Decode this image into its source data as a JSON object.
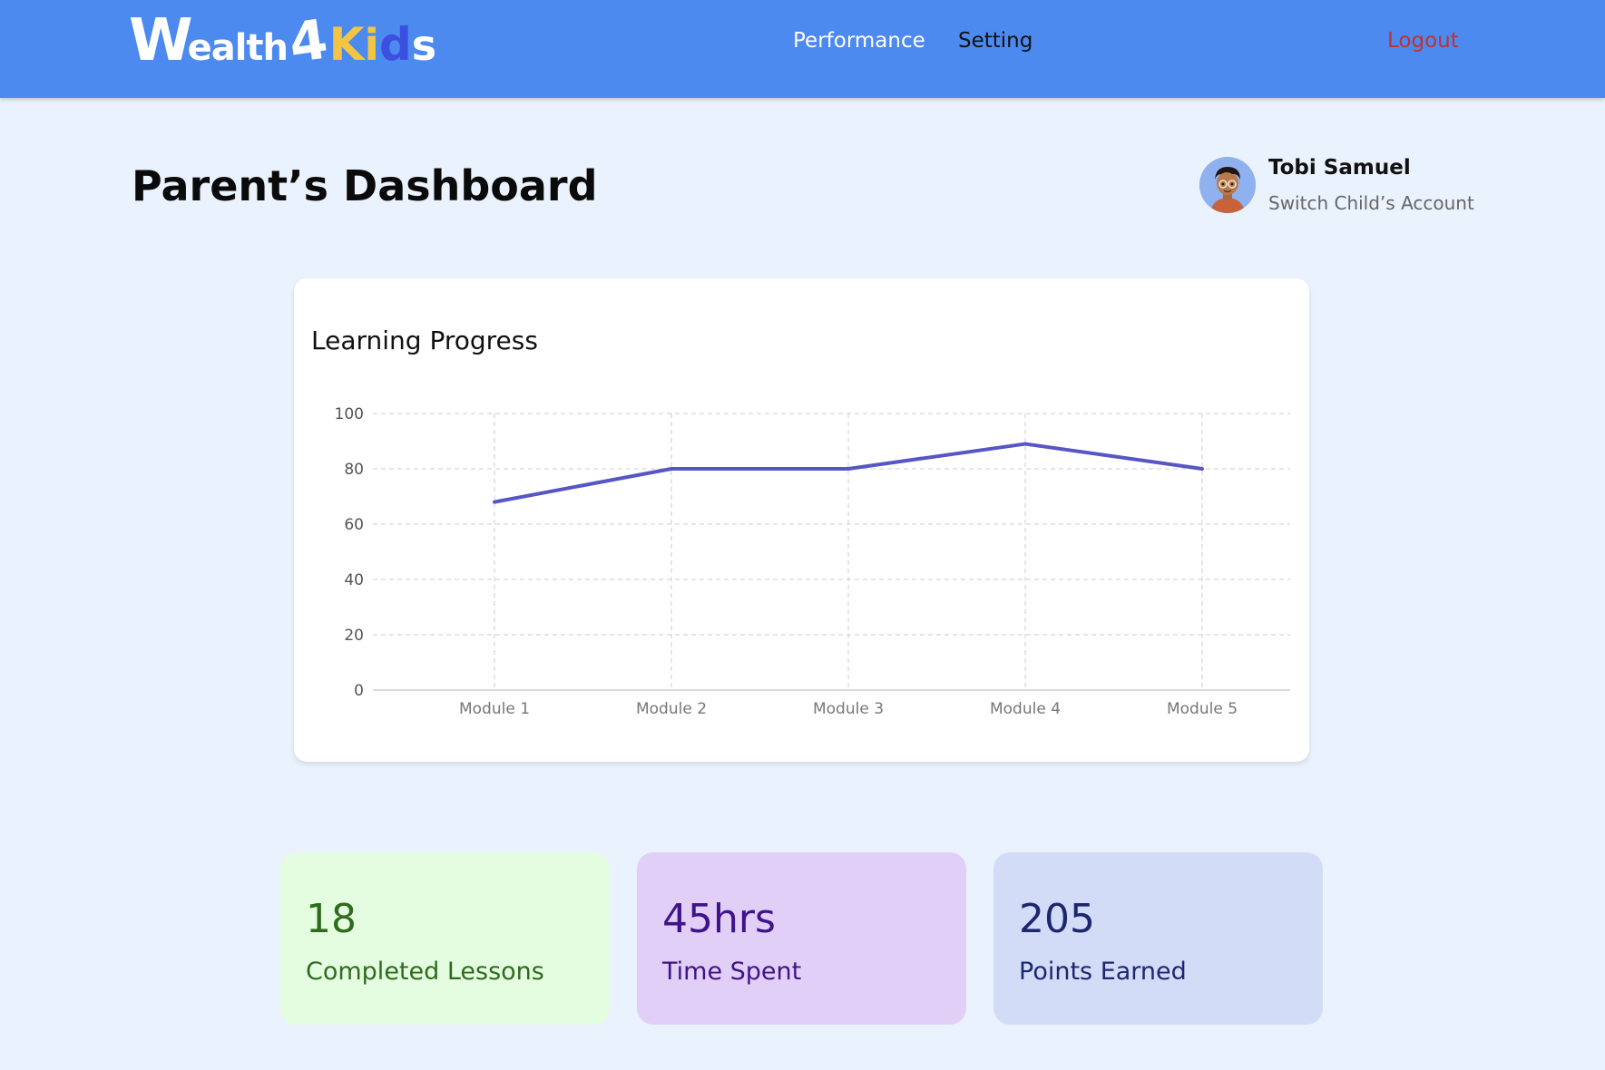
{
  "header": {
    "logo": {
      "w": "W",
      "ealth": "ealth",
      "four": "4",
      "k": "K",
      "i": "i",
      "d": "d",
      "s": "s"
    },
    "nav": {
      "performance": "Performance",
      "setting": "Setting",
      "logout": "Logout"
    }
  },
  "page": {
    "title": "Parent’s Dashboard"
  },
  "user": {
    "name": "Tobi Samuel",
    "switch_label": "Switch Child’s Account"
  },
  "chart_card": {
    "title": "Learning Progress"
  },
  "chart_data": {
    "type": "line",
    "title": "Learning Progress",
    "categories": [
      "Module 1",
      "Module 2",
      "Module 3",
      "Module 4",
      "Module 5"
    ],
    "series": [
      {
        "values": [
          68,
          80,
          80,
          89,
          80
        ],
        "color": "#5656c4"
      }
    ],
    "yticks": [
      0,
      20,
      40,
      60,
      80,
      100
    ],
    "ylim": [
      0,
      100
    ],
    "grid": true,
    "xlabel": "",
    "ylabel": ""
  },
  "stats": {
    "lessons": {
      "value": "18",
      "label": "Completed Lessons"
    },
    "time": {
      "value": "45hrs",
      "label": "Time Spent"
    },
    "points": {
      "value": "205",
      "label": "Points Earned"
    }
  },
  "colors": {
    "header_bg": "#4c8aef",
    "page_bg": "#eaf2fd",
    "line": "#5656c4",
    "logout": "#c0322f"
  }
}
